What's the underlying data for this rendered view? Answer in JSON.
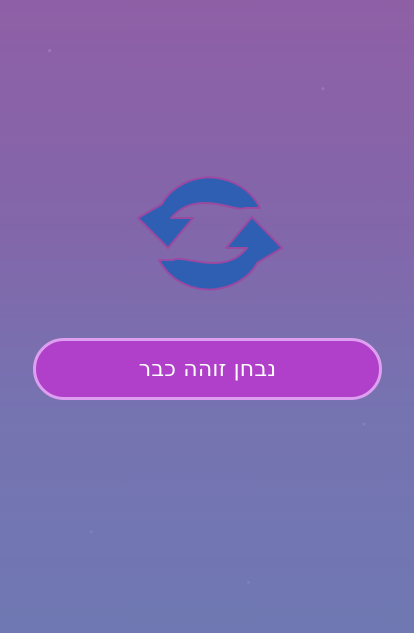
{
  "main": {
    "icon": "refresh-icon",
    "button_label": "נבחן זוהה כבר"
  },
  "colors": {
    "background_top": "#8f5fa6",
    "background_bottom": "#6f78b2",
    "icon_fill": "#2f5fb3",
    "icon_stroke": "#9a4aa1",
    "button_fill": "#b03fca",
    "button_border": "#de9ff0"
  }
}
